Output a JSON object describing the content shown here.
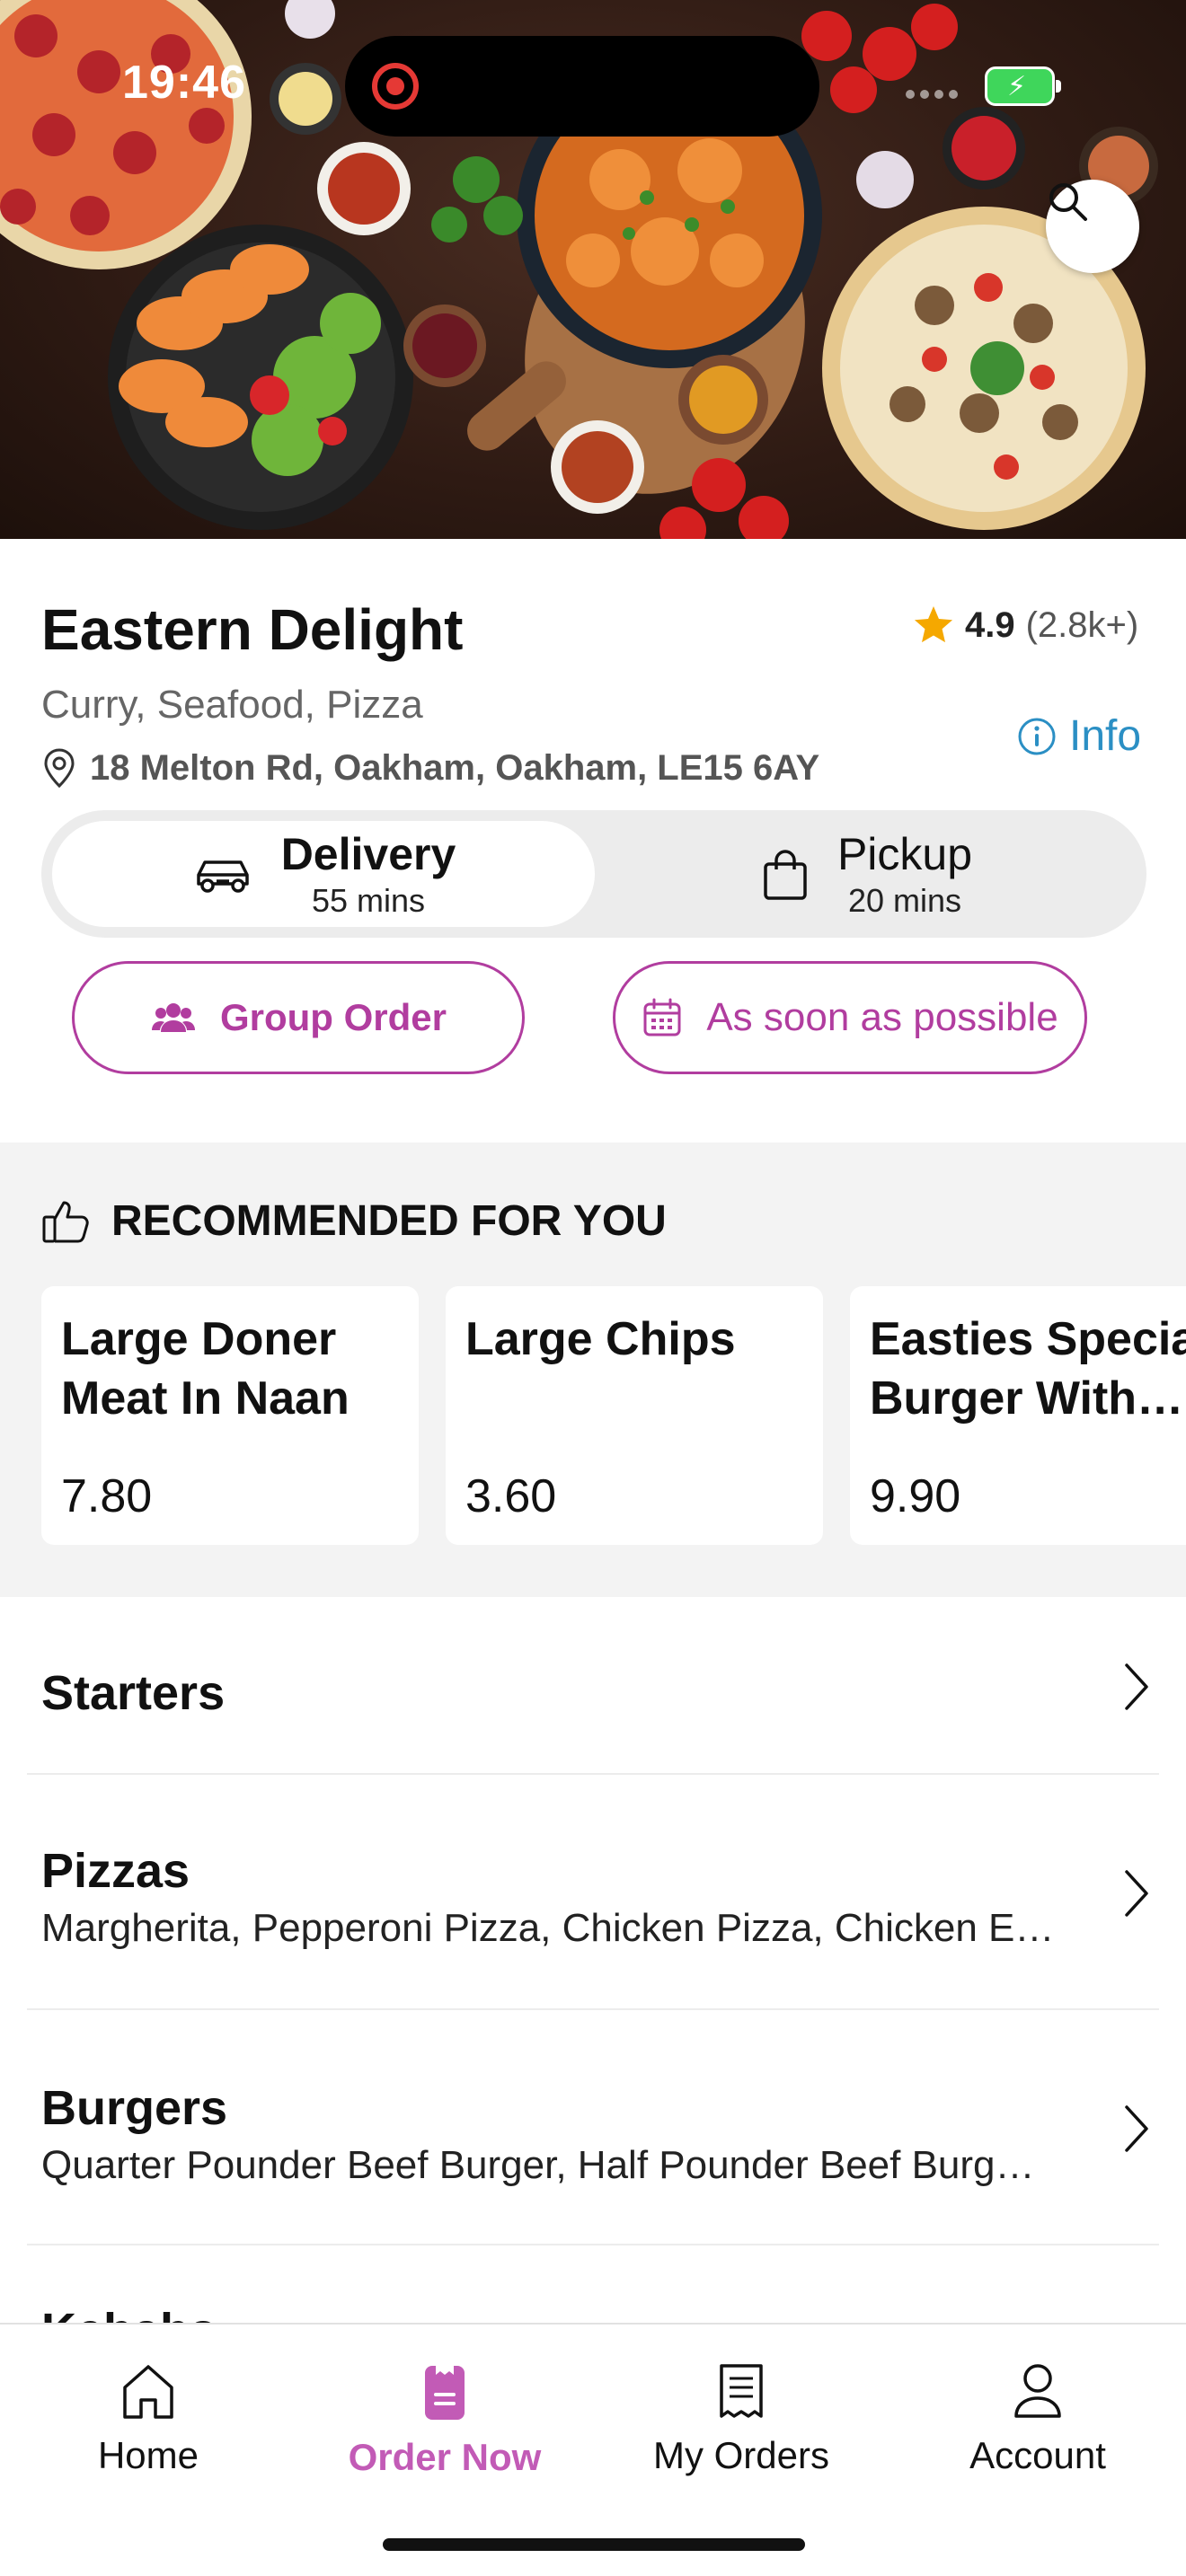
{
  "status_bar": {
    "time": "19:46"
  },
  "restaurant": {
    "name": "Eastern Delight",
    "rating": "4.9",
    "rating_count": "(2.8k+)",
    "cuisines": "Curry, Seafood, Pizza",
    "address": "18 Melton Rd, Oakham, Oakham, LE15 6AY",
    "info_label": "Info"
  },
  "fulfillment": {
    "delivery": {
      "label": "Delivery",
      "time": "55 mins",
      "selected": true
    },
    "pickup": {
      "label": "Pickup",
      "time": "20 mins",
      "selected": false
    }
  },
  "actions": {
    "group_order": "Group Order",
    "schedule": "As soon as possible"
  },
  "recommended": {
    "title": "RECOMMENDED FOR YOU",
    "items": [
      {
        "name_line1": "Large Doner",
        "name_line2": "Meat In Naan",
        "price": "7.80"
      },
      {
        "name_line1": "Large Chips",
        "name_line2": "",
        "price": "3.60"
      },
      {
        "name_line1": "Easties Specia",
        "name_line2": "Burger With…",
        "price": "9.90"
      }
    ]
  },
  "categories": [
    {
      "name": "Starters",
      "description": ""
    },
    {
      "name": "Pizzas",
      "description": "Margherita, Pepperoni Pizza, Chicken Pizza, Chicken E…"
    },
    {
      "name": "Burgers",
      "description": "Quarter Pounder Beef Burger, Half Pounder Beef Burg…"
    },
    {
      "name": "Kebabs",
      "description": ""
    }
  ],
  "tabs": [
    {
      "label": "Home",
      "icon": "home-icon",
      "active": false
    },
    {
      "label": "Order Now",
      "icon": "order-icon",
      "active": true
    },
    {
      "label": "My Orders",
      "icon": "receipt-icon",
      "active": false
    },
    {
      "label": "Account",
      "icon": "person-icon",
      "active": false
    }
  ],
  "colors": {
    "accent": "#b13d9f",
    "tab_active": "#c25bb6",
    "info_link": "#2b8fc4",
    "star": "#f5a800"
  }
}
